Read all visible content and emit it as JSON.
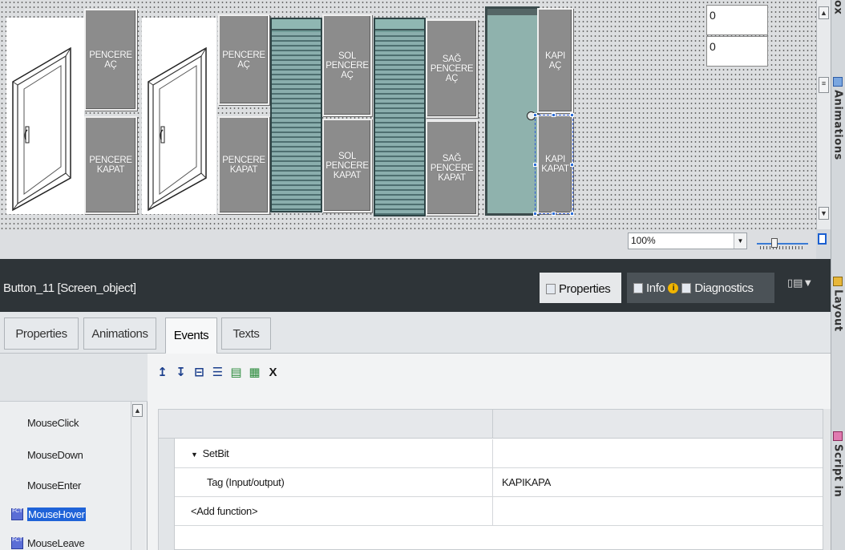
{
  "canvas": {
    "buttons": {
      "pencere_ac_1": "PENCERE\nAÇ",
      "pencere_kapat_1": "PENCERE\nKAPAT",
      "pencere_ac_2": "PENCERE\nAÇ",
      "pencere_kapat_2": "PENCERE\nKAPAT",
      "sol_pencere_ac": "SOL\nPENCERE\nAÇ",
      "sol_pencere_kapat": "SOL\nPENCERE\nKAPAT",
      "sag_pencere_ac": "SAĞ\nPENCERE\nAÇ",
      "sag_pencere_kapat": "SAĞ\nPENCERE\nKAPAT",
      "kapi_ac": "KAPI\nAÇ",
      "kapi_kapat": "KAPI\nKAPAT"
    },
    "io_fields": [
      "0",
      "0"
    ],
    "zoom": "100%"
  },
  "inspector": {
    "title": "Button_11 [Screen_object]",
    "tabs": {
      "properties": "Properties",
      "info": "Info",
      "diagnostics": "Diagnostics"
    },
    "subtabs": [
      "Properties",
      "Animations",
      "Events",
      "Texts"
    ],
    "active_subtab": "Events"
  },
  "events": [
    {
      "label": "MouseClick"
    },
    {
      "label": "MouseDown"
    },
    {
      "label": "MouseEnter"
    },
    {
      "label": "MouseHover",
      "selected": true
    },
    {
      "label": "MouseLeave"
    }
  ],
  "function_list": {
    "rows": [
      {
        "name": "SetBit",
        "value": ""
      },
      {
        "name": "Tag (Input/output)",
        "value": "KAPIKAPA"
      },
      {
        "name": "<Add function>",
        "value": ""
      }
    ]
  },
  "task_cards": [
    "Animations",
    "Layout",
    "Script in"
  ],
  "colors": {
    "selection": "#1f63d8",
    "shutter": "#6f9a97",
    "door": "#8fb2ad",
    "panel_header": "#2e3438"
  }
}
